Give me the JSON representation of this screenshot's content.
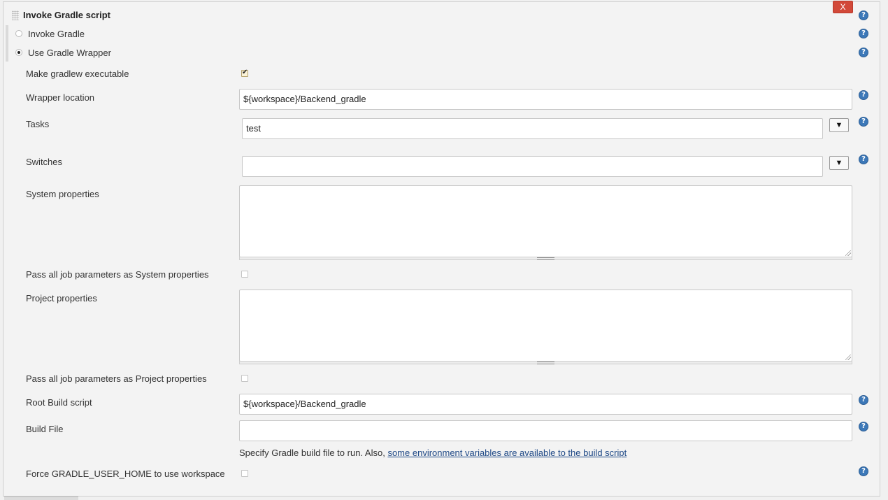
{
  "section": {
    "title": "Invoke Gradle script",
    "delete_label": "X",
    "help_glyph": "?"
  },
  "mode": {
    "options": [
      {
        "label": "Invoke Gradle",
        "selected": false
      },
      {
        "label": "Use Gradle Wrapper",
        "selected": true
      }
    ]
  },
  "form": {
    "make_executable": {
      "label": "Make gradlew executable",
      "checked": true
    },
    "wrapper_location": {
      "label": "Wrapper location",
      "value": "${workspace}/Backend_gradle"
    },
    "tasks": {
      "label": "Tasks",
      "value": "test",
      "dropdown_glyph": "▼"
    },
    "switches": {
      "label": "Switches",
      "value": "",
      "dropdown_glyph": "▼"
    },
    "system_properties": {
      "label": "System properties",
      "value": ""
    },
    "pass_system": {
      "label": "Pass all job parameters as System properties",
      "checked": false
    },
    "project_properties": {
      "label": "Project properties",
      "value": ""
    },
    "pass_project": {
      "label": "Pass all job parameters as Project properties",
      "checked": false
    },
    "root_build_script": {
      "label": "Root Build script",
      "value": "${workspace}/Backend_gradle"
    },
    "build_file": {
      "label": "Build File",
      "value": "",
      "description": "Specify Gradle build file to run. Also, ",
      "description_link": "some environment variables are available to the build script"
    },
    "force_user_home": {
      "label": "Force GRADLE_USER_HOME to use workspace",
      "checked": false
    }
  },
  "colors": {
    "delete_button": "#d24939",
    "help_icon": "#3c78b8",
    "link": "#204a87"
  }
}
